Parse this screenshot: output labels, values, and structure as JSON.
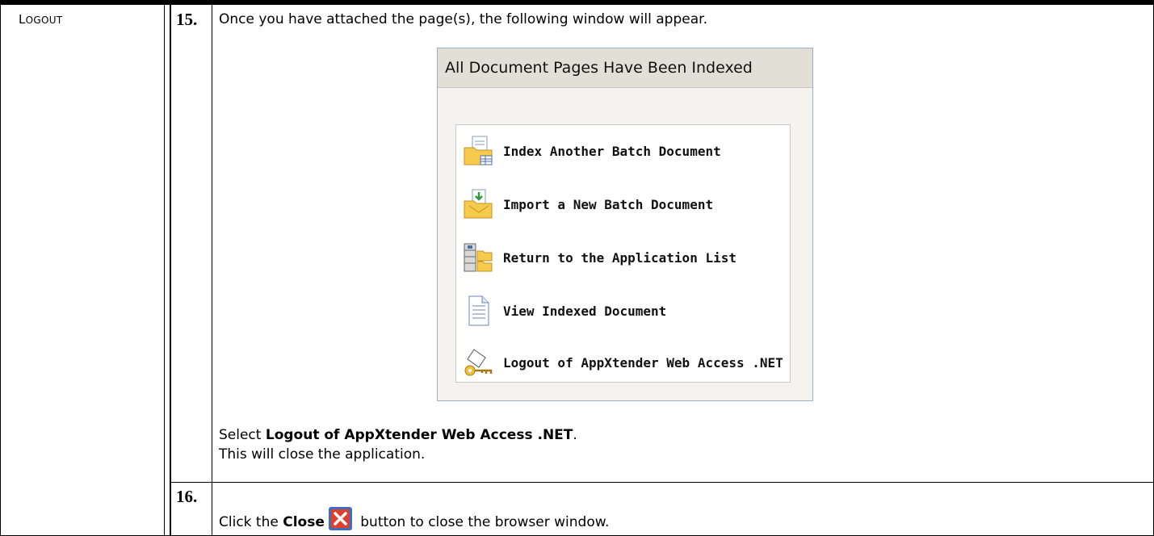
{
  "left_column": {
    "label_first": "L",
    "label_rest": "OGOUT"
  },
  "steps": [
    {
      "number": "15.",
      "intro": "Once you have attached the page(s), the following window will appear."
    },
    {
      "number": "16.",
      "text_before": "Click the ",
      "bold": "Close",
      "text_after": " button to close the browser window."
    }
  ],
  "dialog": {
    "title": "All Document Pages Have Been Indexed",
    "options": [
      {
        "label": "Index Another Batch Document",
        "icon": "folder-table-icon"
      },
      {
        "label": "Import a New Batch Document",
        "icon": "folder-import-icon"
      },
      {
        "label": "Return to the Application List",
        "icon": "application-list-icon"
      },
      {
        "label": "View Indexed Document",
        "icon": "document-icon"
      },
      {
        "label": "Logout of AppXtender Web Access .NET",
        "icon": "key-logout-icon"
      }
    ]
  },
  "instructions": {
    "select_prefix": "Select ",
    "select_bold": "Logout of AppXtender Web Access .NET",
    "select_suffix": ".",
    "close_note": "This will close the application."
  },
  "colors": {
    "dialog_border": "#9bb0c9",
    "title_bg": "#e2dfd6",
    "close_red": "#e0402a",
    "close_border": "#3a6fc4"
  }
}
